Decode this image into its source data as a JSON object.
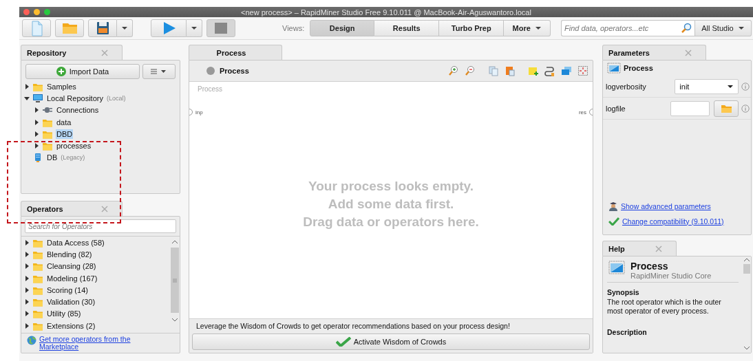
{
  "window": {
    "title": "<new process> – RapidMiner Studio Free 9.10.011 @ MacBook-Air-Aguswantoro.local"
  },
  "toolbar": {
    "views_label": "Views:",
    "views": [
      {
        "label": "Design",
        "selected": true,
        "kind": "view"
      },
      {
        "label": "Results",
        "selected": false,
        "kind": "view"
      },
      {
        "label": "Turbo Prep",
        "selected": false,
        "kind": "view"
      },
      {
        "label": "More",
        "selected": false,
        "kind": "menu"
      }
    ],
    "search": {
      "placeholder": "Find data, operators...etc"
    },
    "scope": "All Studio"
  },
  "repository": {
    "tab": "Repository",
    "import_button": "Import Data",
    "tree": [
      {
        "label": "Samples",
        "kind": "folder",
        "expanded": false,
        "selected": false
      },
      {
        "label": "Local Repository",
        "note": "(Local)",
        "kind": "computer",
        "expanded": true,
        "selected": false,
        "children": [
          {
            "label": "Connections",
            "kind": "plug",
            "expanded": false,
            "selected": false
          },
          {
            "label": "data",
            "kind": "folder",
            "expanded": false,
            "selected": false
          },
          {
            "label": "DBD",
            "kind": "folder",
            "expanded": false,
            "selected": true
          },
          {
            "label": "processes",
            "kind": "folder",
            "expanded": false,
            "selected": false
          }
        ]
      },
      {
        "label": "DB",
        "note": "(Legacy)",
        "kind": "database",
        "selected": false
      }
    ]
  },
  "operators": {
    "tab": "Operators",
    "search": {
      "placeholder": "Search for Operators"
    },
    "groups": [
      {
        "label": "Data Access (58)",
        "expanded": false
      },
      {
        "label": "Blending (82)",
        "expanded": false
      },
      {
        "label": "Cleansing (28)",
        "expanded": false
      },
      {
        "label": "Modeling (167)",
        "expanded": false
      },
      {
        "label": "Scoring (14)",
        "expanded": false
      },
      {
        "label": "Validation (30)",
        "expanded": false
      },
      {
        "label": "Utility (85)",
        "expanded": false
      },
      {
        "label": "Extensions (2)",
        "expanded": false
      }
    ],
    "marketplace_link": "Get more operators from the Marketplace"
  },
  "process": {
    "tab": "Process",
    "breadcrumb": "Process",
    "canvas_title": "Process",
    "ports": {
      "input": "inp",
      "output": "res"
    },
    "empty_message": [
      "Your process looks empty.",
      "Add some data first.",
      "Drag data or operators here."
    ],
    "wisdom_text": "Leverage the Wisdom of Crowds to get operator recommendations based on your process design!",
    "wisdom_button": "Activate Wisdom of Crowds"
  },
  "parameters": {
    "tab": "Parameters",
    "operator": "Process",
    "rows": [
      {
        "label": "logverbosity",
        "kind": "select",
        "value": "init"
      },
      {
        "label": "logfile",
        "kind": "file"
      }
    ],
    "links": [
      {
        "label": "Show advanced parameters",
        "kind": "advanced"
      },
      {
        "label": "Change compatibility (9.10.011)",
        "kind": "compatibility"
      }
    ]
  },
  "help": {
    "tab": "Help",
    "title": "Process",
    "subtitle": "RapidMiner Studio Core",
    "sections": [
      {
        "heading": "Synopsis",
        "text": "The root operator which is the outer most operator of every process."
      },
      {
        "heading": "Description"
      }
    ]
  }
}
